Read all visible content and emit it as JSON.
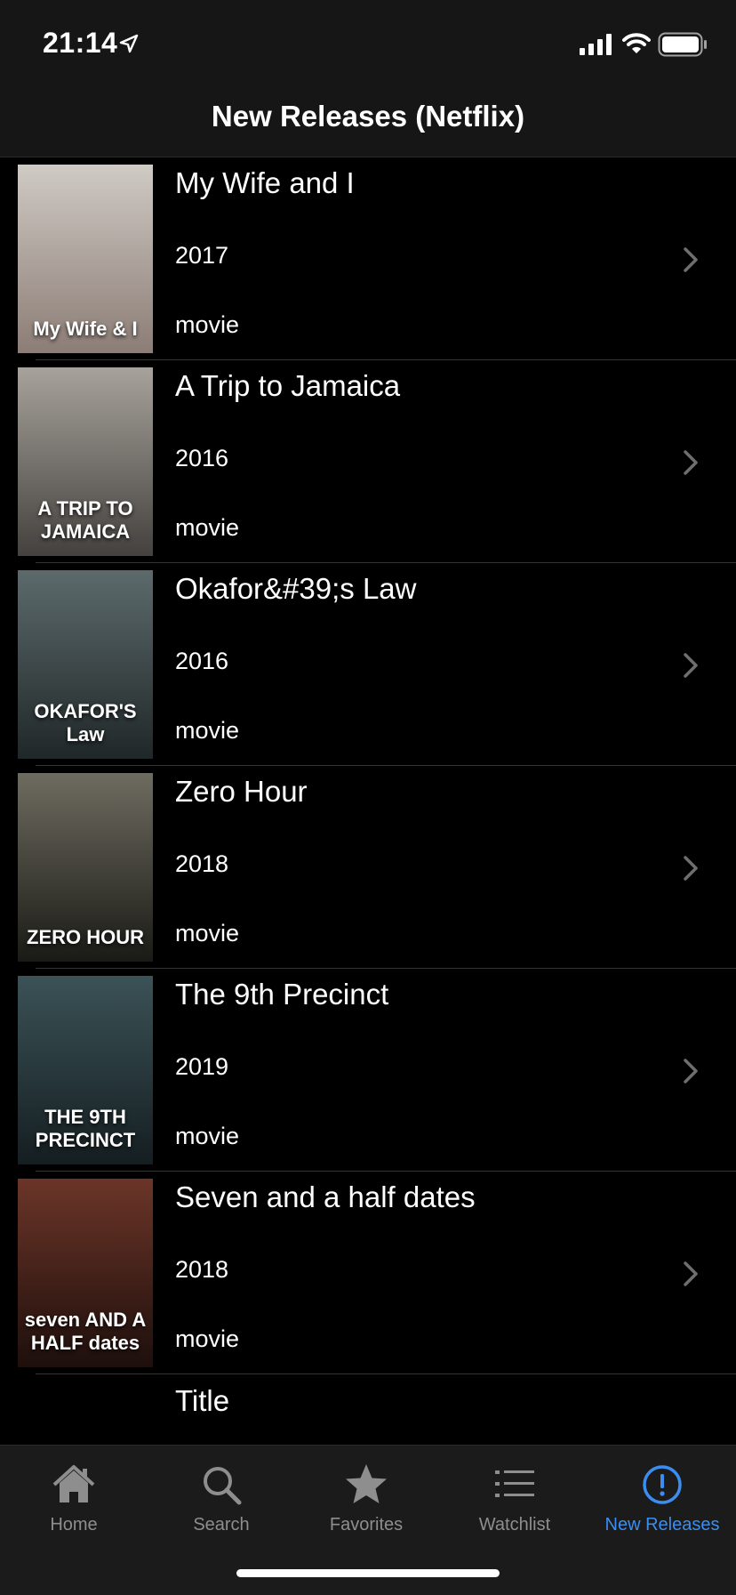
{
  "status_bar": {
    "time": "21:14"
  },
  "navbar": {
    "title": "New Releases (Netflix)"
  },
  "items": [
    {
      "title": "My Wife and I",
      "year": "2017",
      "type": "movie",
      "poster_text": "My Wife & I",
      "poster_colors": [
        "#cfcac4",
        "#8c7d76"
      ]
    },
    {
      "title": "A Trip to Jamaica",
      "year": "2016",
      "type": "movie",
      "poster_text": "A TRIP TO JAMAICA",
      "poster_colors": [
        "#a7a29b",
        "#44413e"
      ]
    },
    {
      "title": "Okafor&#39;s Law",
      "year": "2016",
      "type": "movie",
      "poster_text": "OKAFOR'S Law",
      "poster_colors": [
        "#5c6a6c",
        "#202728"
      ]
    },
    {
      "title": "Zero Hour",
      "year": "2018",
      "type": "movie",
      "poster_text": "ZERO HOUR",
      "poster_colors": [
        "#6e6c60",
        "#1a1a16"
      ]
    },
    {
      "title": "The 9th Precinct",
      "year": "2019",
      "type": "movie",
      "poster_text": "THE 9TH PRECINCT",
      "poster_colors": [
        "#3b5256",
        "#151e21"
      ]
    },
    {
      "title": "Seven and a half dates",
      "year": "2018",
      "type": "movie",
      "poster_text": "seven AND A HALF dates",
      "poster_colors": [
        "#6b3528",
        "#1e0f0c"
      ]
    }
  ],
  "partial_item": {
    "title": "Title"
  },
  "tabs": [
    {
      "label": "Home",
      "icon": "house-icon",
      "active": false
    },
    {
      "label": "Search",
      "icon": "search-icon",
      "active": false
    },
    {
      "label": "Favorites",
      "icon": "star-icon",
      "active": false
    },
    {
      "label": "Watchlist",
      "icon": "list-icon",
      "active": false
    },
    {
      "label": "New Releases",
      "icon": "exclamation-circle-icon",
      "active": true
    }
  ],
  "colors": {
    "accent": "#3b8ef0",
    "inactive": "#8e8e8e",
    "bar_bg": "#1b1b1b"
  }
}
